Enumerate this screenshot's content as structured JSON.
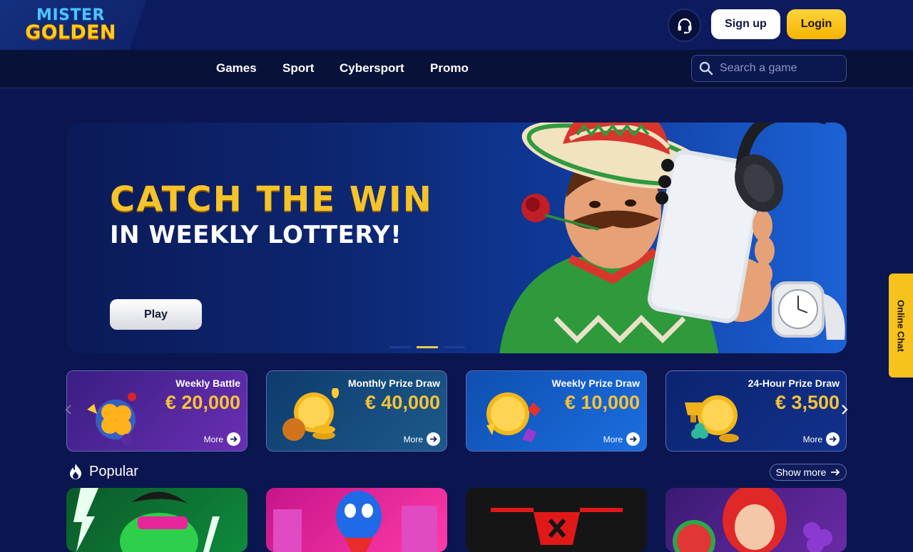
{
  "header": {
    "logo": {
      "line1": "MISTER",
      "line2": "GOLDEN"
    },
    "support_icon": "headset-icon",
    "signup_label": "Sign up",
    "login_label": "Login"
  },
  "nav": {
    "items": [
      {
        "label": "Games"
      },
      {
        "label": "Sport"
      },
      {
        "label": "Cybersport"
      },
      {
        "label": "Promo"
      }
    ],
    "search_placeholder": "Search a game",
    "search_icon": "search-icon"
  },
  "hero": {
    "title": "CATCH THE WIN",
    "subtitle": "IN WEEKLY LOTTERY!",
    "play_label": "Play",
    "slides_total": 3,
    "active_slide": 2
  },
  "promos": [
    {
      "title": "Weekly Battle",
      "amount": "€ 20,000",
      "more": "More"
    },
    {
      "title": "Monthly Prize Draw",
      "amount": "€ 40,000",
      "more": "More"
    },
    {
      "title": "Weekly Prize Draw",
      "amount": "€ 10,000",
      "more": "More"
    },
    {
      "title": "24-Hour Prize Draw",
      "amount": "€ 3,500",
      "more": "More"
    }
  ],
  "popular": {
    "title": "Popular",
    "show_more": "Show more"
  },
  "online_chat": "Online Chat",
  "colors": {
    "page_bg": "#0b1650",
    "accent_gold": "#f6c23a",
    "login_yellow": "#ffc61a"
  }
}
